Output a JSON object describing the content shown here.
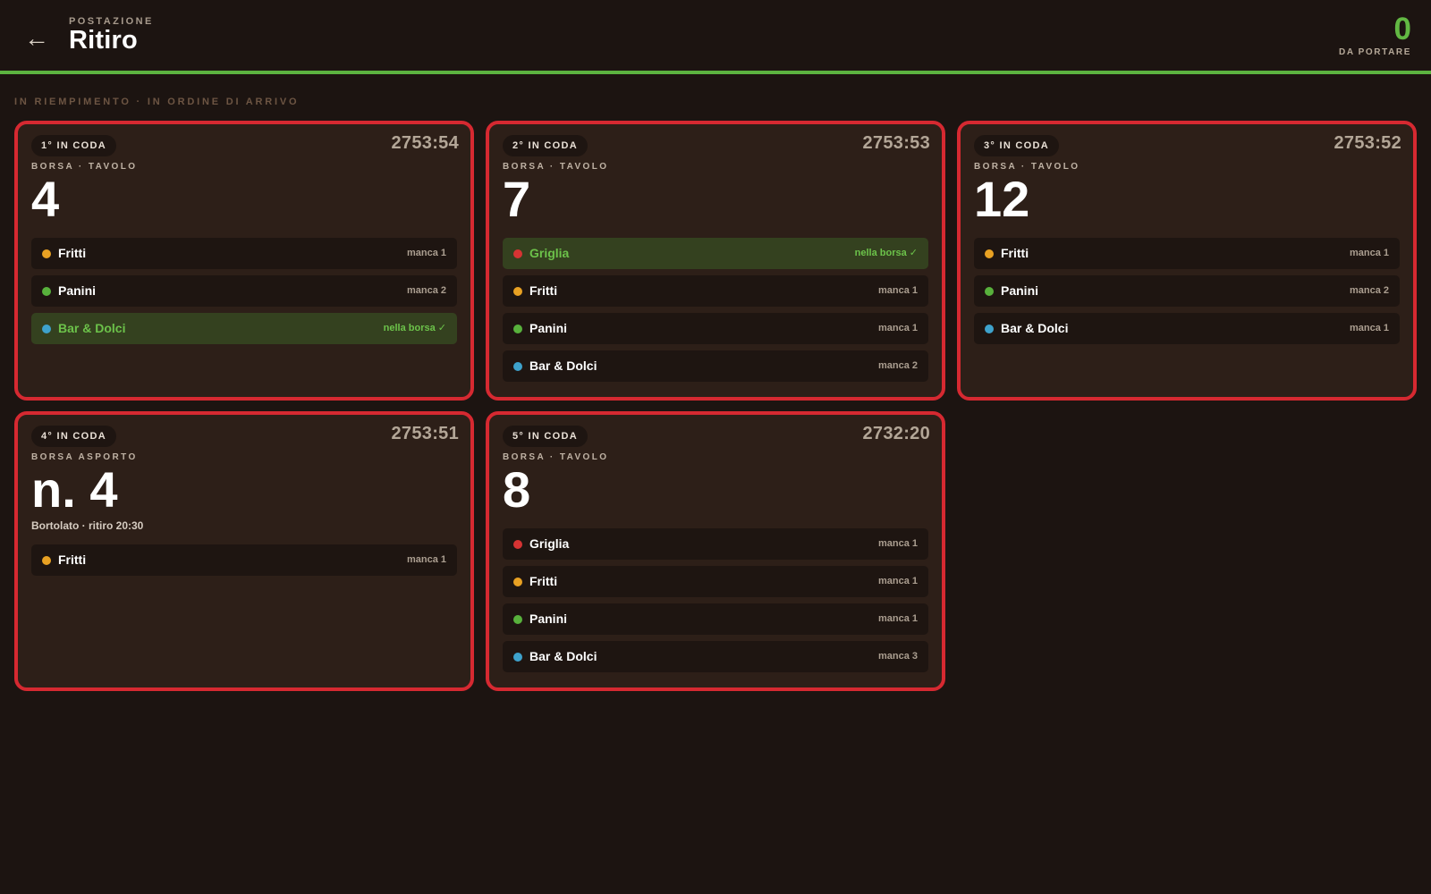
{
  "header": {
    "back_icon": "arrow-left-icon",
    "eyebrow": "POSTAZIONE",
    "title": "Ritiro",
    "counter_value": "0",
    "counter_label": "DA PORTARE"
  },
  "section_label": "IN RIEMPIMENTO · IN ORDINE DI ARRIVO",
  "colors": {
    "accent_green": "#5cb340",
    "card_border": "#d62931",
    "griglia": "#d63333",
    "fritti": "#e8a123",
    "panini": "#58b13c",
    "bar_dolci": "#3ea2cc"
  },
  "cards": [
    {
      "queue": "1° IN CODA",
      "elapsed": "2753:54",
      "kind": "BORSA · TAVOLO",
      "number": "4",
      "note": "",
      "rows": [
        {
          "name": "Fritti",
          "status": "manca 1",
          "color": "#e8a123",
          "done": false
        },
        {
          "name": "Panini",
          "status": "manca 2",
          "color": "#58b13c",
          "done": false
        },
        {
          "name": "Bar & Dolci",
          "status": "nella borsa ✓",
          "color": "#3ea2cc",
          "done": true
        }
      ]
    },
    {
      "queue": "2° IN CODA",
      "elapsed": "2753:53",
      "kind": "BORSA · TAVOLO",
      "number": "7",
      "note": "",
      "rows": [
        {
          "name": "Griglia",
          "status": "nella borsa ✓",
          "color": "#d63333",
          "done": true
        },
        {
          "name": "Fritti",
          "status": "manca 1",
          "color": "#e8a123",
          "done": false
        },
        {
          "name": "Panini",
          "status": "manca 1",
          "color": "#58b13c",
          "done": false
        },
        {
          "name": "Bar & Dolci",
          "status": "manca 2",
          "color": "#3ea2cc",
          "done": false
        }
      ]
    },
    {
      "queue": "3° IN CODA",
      "elapsed": "2753:52",
      "kind": "BORSA · TAVOLO",
      "number": "12",
      "note": "",
      "rows": [
        {
          "name": "Fritti",
          "status": "manca 1",
          "color": "#e8a123",
          "done": false
        },
        {
          "name": "Panini",
          "status": "manca 2",
          "color": "#58b13c",
          "done": false
        },
        {
          "name": "Bar & Dolci",
          "status": "manca 1",
          "color": "#3ea2cc",
          "done": false
        }
      ]
    },
    {
      "queue": "4° IN CODA",
      "elapsed": "2753:51",
      "kind": "BORSA ASPORTO",
      "number": "n. 4",
      "note": "Bortolato · ritiro 20:30",
      "rows": [
        {
          "name": "Fritti",
          "status": "manca 1",
          "color": "#e8a123",
          "done": false
        }
      ]
    },
    {
      "queue": "5° IN CODA",
      "elapsed": "2732:20",
      "kind": "BORSA · TAVOLO",
      "number": "8",
      "note": "",
      "rows": [
        {
          "name": "Griglia",
          "status": "manca 1",
          "color": "#d63333",
          "done": false
        },
        {
          "name": "Fritti",
          "status": "manca 1",
          "color": "#e8a123",
          "done": false
        },
        {
          "name": "Panini",
          "status": "manca 1",
          "color": "#58b13c",
          "done": false
        },
        {
          "name": "Bar & Dolci",
          "status": "manca 3",
          "color": "#3ea2cc",
          "done": false
        }
      ]
    }
  ]
}
